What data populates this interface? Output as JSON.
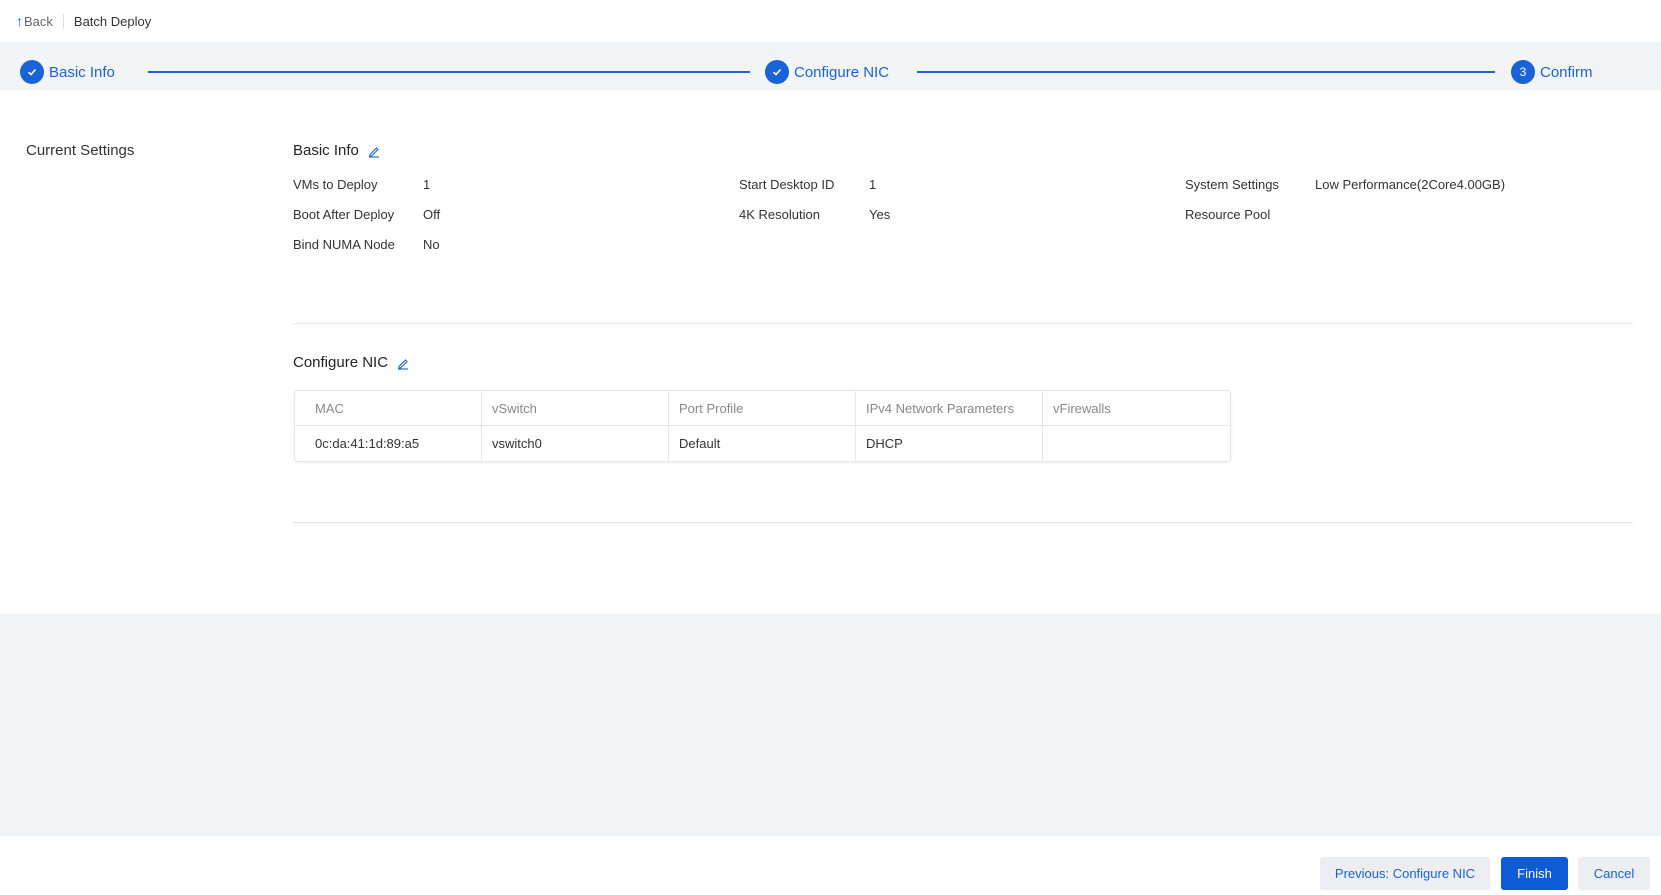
{
  "header": {
    "back_label": "Back",
    "title": "Batch Deploy"
  },
  "steps": [
    {
      "label": "Basic Info",
      "state": "done"
    },
    {
      "label": "Configure NIC",
      "state": "done"
    },
    {
      "label": "Confirm",
      "number": "3",
      "state": "current"
    }
  ],
  "section_label": "Current Settings",
  "basic_info": {
    "title": "Basic Info",
    "fields": {
      "vms_label": "VMs to Deploy",
      "vms_value": "1",
      "boot_label": "Boot After Deploy",
      "boot_value": "Off",
      "numa_label": "Bind NUMA Node",
      "numa_value": "No",
      "start_id_label": "Start Desktop ID",
      "start_id_value": "1",
      "res4k_label": "4K Resolution",
      "res4k_value": "Yes",
      "system_label": "System Settings",
      "system_value": "Low Performance(2Core4.00GB)",
      "pool_label": "Resource Pool",
      "pool_value": ""
    }
  },
  "configure_nic": {
    "title": "Configure NIC",
    "columns": [
      "MAC",
      "vSwitch",
      "Port Profile",
      "IPv4 Network Parameters",
      "vFirewalls"
    ],
    "rows": [
      [
        "0c:da:41:1d:89:a5",
        "vswitch0",
        "Default",
        "DHCP",
        ""
      ]
    ]
  },
  "footer": {
    "previous_label": "Previous: Configure NIC",
    "finish_label": "Finish",
    "cancel_label": "Cancel"
  },
  "colors": {
    "accent": "#1a63d6",
    "background": "#f3f4f6"
  }
}
